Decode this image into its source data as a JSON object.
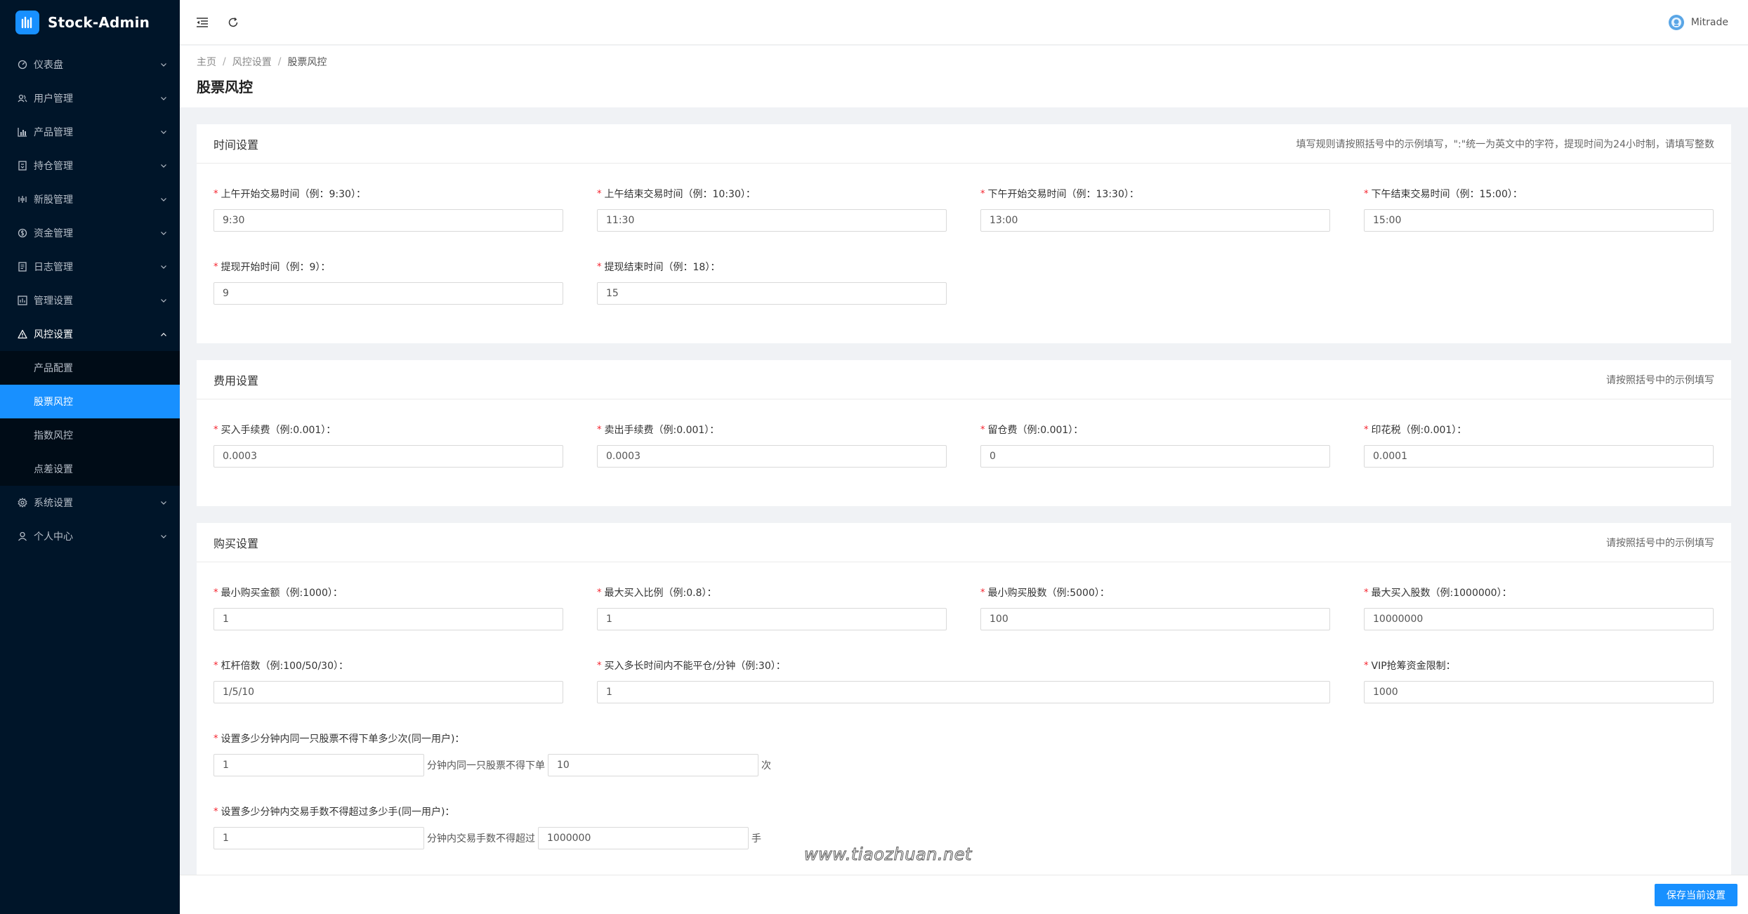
{
  "app": {
    "title": "Stock-Admin"
  },
  "sidebar": {
    "items": [
      {
        "label": "仪表盘",
        "icon": "dashboard-icon"
      },
      {
        "label": "用户管理",
        "icon": "users-icon"
      },
      {
        "label": "产品管理",
        "icon": "chart-icon"
      },
      {
        "label": "持仓管理",
        "icon": "position-icon"
      },
      {
        "label": "新股管理",
        "icon": "signal-icon"
      },
      {
        "label": "资金管理",
        "icon": "money-icon"
      },
      {
        "label": "日志管理",
        "icon": "log-icon"
      },
      {
        "label": "管理设置",
        "icon": "settings-table-icon"
      },
      {
        "label": "风控设置",
        "icon": "warning-icon"
      }
    ],
    "risk_sub": [
      "产品配置",
      "股票风控",
      "指数风控",
      "点差设置"
    ],
    "after": [
      {
        "label": "系统设置",
        "icon": "gear-icon"
      },
      {
        "label": "个人中心",
        "icon": "user-icon"
      }
    ]
  },
  "header": {
    "user": "Mitrade"
  },
  "breadcrumb": [
    "主页",
    "风控设置",
    "股票风控"
  ],
  "page_title": "股票风控",
  "time_settings": {
    "title": "时间设置",
    "hint": "填写规则请按照括号中的示例填写，\":\"统一为英文中的字符，提现时间为24小时制，请填写整数",
    "fields": [
      {
        "label": "上午开始交易时间（例：9:30）：",
        "value": "9:30"
      },
      {
        "label": "上午结束交易时间（例：10:30）：",
        "value": "11:30"
      },
      {
        "label": "下午开始交易时间（例：13:30）：",
        "value": "13:00"
      },
      {
        "label": "下午结束交易时间（例：15:00）：",
        "value": "15:00"
      },
      {
        "label": "提现开始时间（例：9）：",
        "value": "9"
      },
      {
        "label": "提现结束时间（例：18）：",
        "value": "15"
      }
    ]
  },
  "fee_settings": {
    "title": "费用设置",
    "hint": "请按照括号中的示例填写",
    "fields": [
      {
        "label": "买入手续费（例:0.001）：",
        "value": "0.0003"
      },
      {
        "label": "卖出手续费（例:0.001）：",
        "value": "0.0003"
      },
      {
        "label": "留仓费（例:0.001）：",
        "value": "0"
      },
      {
        "label": "印花税（例:0.001）：",
        "value": "0.0001"
      }
    ]
  },
  "buy_settings": {
    "title": "购买设置",
    "hint": "请按照括号中的示例填写",
    "fields": [
      {
        "label": "最小购买金额（例:1000）：",
        "value": "1"
      },
      {
        "label": "最大买入比例（例:0.8）：",
        "value": "1"
      },
      {
        "label": "最小购买股数（例:5000）：",
        "value": "100"
      },
      {
        "label": "最大买入股数（例:1000000）：",
        "value": "10000000"
      },
      {
        "label": "杠杆倍数（例:100/50/30）：",
        "value": "1/5/10"
      },
      {
        "label": "买入多长时间内不能平仓/分钟（例:30）：",
        "value": "1"
      },
      {
        "label": "VIP抢筹资金限制：",
        "value": "1000"
      }
    ],
    "order_limit": {
      "label": "设置多少分钟内同一只股票不得下单多少次(同一用户)：",
      "minutes": "1",
      "middle": "分钟内同一只股票不得下单",
      "count": "10",
      "unit": "次"
    },
    "lot_limit": {
      "label": "设置多少分钟内交易手数不得超过多少手(同一用户)：",
      "minutes": "1",
      "middle": "分钟内交易手数不得超过",
      "count": "1000000",
      "unit": "手"
    }
  },
  "footer": {
    "save_label": "保存当前设置"
  },
  "watermark": "www.tiaozhuan.net"
}
